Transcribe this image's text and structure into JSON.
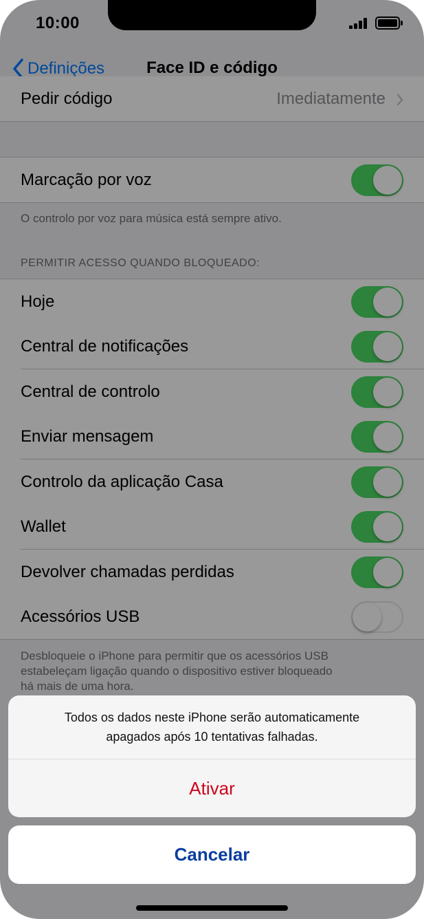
{
  "status_bar": {
    "time": "10:00"
  },
  "nav": {
    "back_label": "Definições",
    "title": "Face ID e código"
  },
  "rows": {
    "require_passcode": {
      "label": "Pedir código",
      "value": "Imediatamente"
    },
    "voice_dial": {
      "label": "Marcação por voz",
      "on": true
    }
  },
  "voice_dial_footnote": "O controlo por voz para música está sempre ativo.",
  "locked_access": {
    "header": "PERMITIR ACESSO QUANDO BLOQUEADO:",
    "items": [
      {
        "label": "Hoje",
        "on": true
      },
      {
        "label": "Central de notificações",
        "on": true
      },
      {
        "label": "Central de controlo",
        "on": true
      },
      {
        "label": "Enviar mensagem",
        "on": true
      },
      {
        "label": "Controlo da aplicação Casa",
        "on": true
      },
      {
        "label": "Wallet",
        "on": true
      },
      {
        "label": "Devolver chamadas perdidas",
        "on": true
      },
      {
        "label": "Acessórios USB",
        "on": false
      }
    ],
    "footnote_lines": [
      "Desbloqueie o iPhone para permitir que os acessórios USB",
      "estabeleçam ligação quando o dispositivo estiver bloqueado",
      "há mais de uma hora."
    ]
  },
  "action_sheet": {
    "message_lines": [
      "Todos os dados neste iPhone serão automaticamente",
      "apagados após 10 tentativas falhadas."
    ],
    "destructive_label": "Ativar",
    "cancel_label": "Cancelar"
  },
  "colors": {
    "toggle_on": "#4cd964",
    "link_blue": "#007aff",
    "destructive_red": "#d0021b",
    "cancel_blue": "#0a3d9e"
  }
}
